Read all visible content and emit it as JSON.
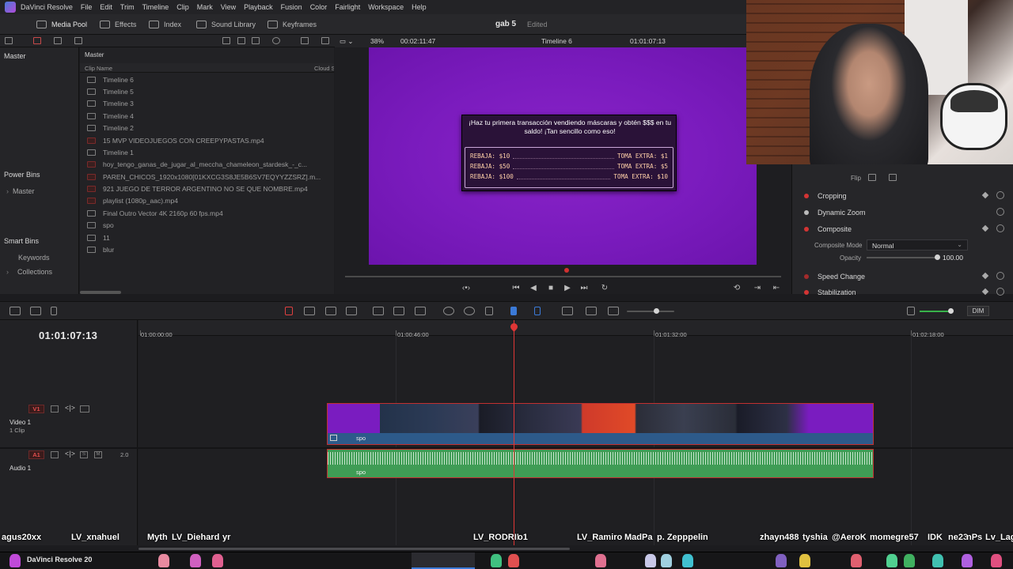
{
  "menubar": {
    "app_name": "DaVinci Resolve",
    "items": [
      "File",
      "Edit",
      "Trim",
      "Timeline",
      "Clip",
      "Mark",
      "View",
      "Playback",
      "Fusion",
      "Color",
      "Fairlight",
      "Workspace",
      "Help"
    ]
  },
  "toolbar": {
    "media_pool": "Media Pool",
    "effects": "Effects",
    "index": "Index",
    "sound_library": "Sound Library",
    "keyframes": "Keyframes",
    "project_title": "gab 5",
    "project_status": "Edited"
  },
  "viewer": {
    "zoom": "38%",
    "duration": "00:02:11:47",
    "timeline_name": "Timeline 6",
    "timecode": "01:01:07:13"
  },
  "bins": {
    "master": "Master",
    "power_bins": "Power Bins",
    "power_master": "Master",
    "smart_bins": "Smart Bins",
    "keywords": "Keywords",
    "collections": "Collections"
  },
  "clips": {
    "header": "Master",
    "col_clip_name": "Clip Name",
    "col_cloud": "Cloud S",
    "rows": [
      "Timeline 6",
      "Timeline 5",
      "Timeline 3",
      "Timeline 4",
      "Timeline 2",
      "15 MVP VIDEOJUEGOS CON CREEPYPASTAS.mp4",
      "Timeline 1",
      "hoy_tengo_ganas_de_jugar_al_meccha_chameleon_stardesk_-_c...",
      "PAREN_CHICOS_1920x1080[01KXCG3S8JE5B6SV7EQYYZZSRZ].m...",
      "921 JUEGO DE TERROR ARGENTINO NO SE QUE NOMBRE.mp4",
      "playlist (1080p_aac).mp4",
      "Final Outro Vector 4K 2160p 60 fps.mp4",
      "spo",
      "11",
      "blur"
    ]
  },
  "promo": {
    "headline": "¡Haz tu primera transacción vendiendo máscaras y obtén $$$ en tu saldo! ¡Tan sencillo como eso!",
    "rows": [
      {
        "left": "REBAJA: $10",
        "right": "TOMA EXTRA: $1"
      },
      {
        "left": "REBAJA: $50",
        "right": "TOMA EXTRA: $5"
      },
      {
        "left": "REBAJA: $100",
        "right": "TOMA EXTRA: $10"
      }
    ]
  },
  "inspector": {
    "flip": "Flip",
    "cropping": "Cropping",
    "dynamic_zoom": "Dynamic Zoom",
    "composite": "Composite",
    "composite_mode_label": "Composite Mode",
    "composite_mode_value": "Normal",
    "opacity_label": "Opacity",
    "opacity_value": "100.00",
    "opacity_fraction": 1.0,
    "speed_change": "Speed Change",
    "stabilization": "Stabilization"
  },
  "timeline": {
    "timecode": "01:01:07:13",
    "ruler": [
      "01:00:00:00",
      "01:00:46:00",
      "01:01:32:00",
      "01:02:18:00"
    ],
    "v1_badge": "V1",
    "v1_name": "Video 1",
    "v1_clips": "1 Clip",
    "a1_badge": "A1",
    "a1_name": "Audio 1",
    "a1_s": "S",
    "a1_m": "M",
    "a1_channels": "2.0",
    "video_clip_name": "spo",
    "audio_clip_name": "spo",
    "dim": "DIM"
  },
  "chat": [
    "agus20xx",
    "LV_xnahuel",
    "Myth",
    "LV_Diehard",
    "yr",
    "LV_RODRII",
    "o1",
    "LV_Ramiro",
    "MadPa",
    "p. Zepppelin",
    "zhayn488",
    "tyshia",
    "@AeroK",
    "momegre57",
    "IDK",
    "ne23",
    "nPs",
    "Lv_Lag"
  ],
  "taskbar": {
    "app": "DaVinci Resolve 20"
  },
  "colors": {
    "accent_red": "#e03636",
    "video_clip": "#2d5a8a",
    "audio_clip": "#3f9c55",
    "viewer_purple": "#7a1bbd"
  }
}
